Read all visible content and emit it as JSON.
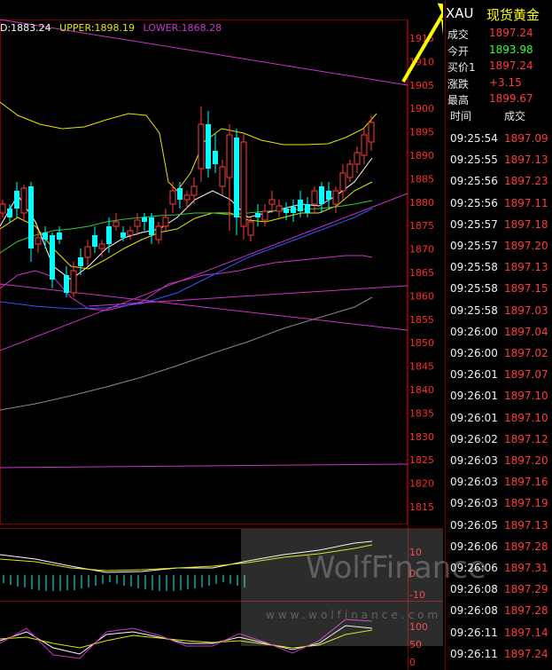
{
  "indicator_line": {
    "mid": "D:1883.24",
    "upper": "UPPER:1898.19",
    "lower": "LOWER:1868.28"
  },
  "price_axis": [
    "1915",
    "1910",
    "1905",
    "1900",
    "1895",
    "1890",
    "1885",
    "1880",
    "1875",
    "1870",
    "1865",
    "1860",
    "1855",
    "1850",
    "1845",
    "1840",
    "1835",
    "1830",
    "1825",
    "1820",
    "1815"
  ],
  "sub_axis_1": [
    "10",
    "0",
    "-10"
  ],
  "sub_axis_2": [
    "100",
    "50",
    "0"
  ],
  "quote": {
    "symbol": "XAU",
    "name": "现货黄金",
    "rows": [
      {
        "label": "成交",
        "value": "1897.24",
        "color": "#ff3b3b"
      },
      {
        "label": "今开",
        "value": "1893.98",
        "color": "#33ff33"
      },
      {
        "label": "买价1",
        "value": "1897.24",
        "color": "#ff3b3b"
      },
      {
        "label": "涨跌",
        "value": "+3.15",
        "color": "#ff3b3b"
      },
      {
        "label": "最高",
        "value": "1899.67",
        "color": "#ff3b3b"
      }
    ]
  },
  "ticks_header": {
    "time": "时间",
    "price": "成交"
  },
  "ticks": [
    {
      "time": "09:25:54",
      "price": "1897.09"
    },
    {
      "time": "09:25:55",
      "price": "1897.13"
    },
    {
      "time": "09:25:56",
      "price": "1897.23"
    },
    {
      "time": "09:25:56",
      "price": "1897.11"
    },
    {
      "time": "09:25:57",
      "price": "1897.18"
    },
    {
      "time": "09:25:57",
      "price": "1897.20"
    },
    {
      "time": "09:25:58",
      "price": "1897.13"
    },
    {
      "time": "09:25:58",
      "price": "1897.15"
    },
    {
      "time": "09:25:58",
      "price": "1897.03"
    },
    {
      "time": "09:26:00",
      "price": "1897.04"
    },
    {
      "time": "09:26:00",
      "price": "1897.02"
    },
    {
      "time": "09:26:01",
      "price": "1897.07"
    },
    {
      "time": "09:26:01",
      "price": "1897.10"
    },
    {
      "time": "09:26:01",
      "price": "1897.10"
    },
    {
      "time": "09:26:02",
      "price": "1897.12"
    },
    {
      "time": "09:26:03",
      "price": "1897.20"
    },
    {
      "time": "09:26:03",
      "price": "1897.16"
    },
    {
      "time": "09:26:03",
      "price": "1897.19"
    },
    {
      "time": "09:26:05",
      "price": "1897.13"
    },
    {
      "time": "09:26:06",
      "price": "1897.28"
    },
    {
      "time": "09:26:06",
      "price": "1897.31"
    },
    {
      "time": "09:26:08",
      "price": "1897.29"
    },
    {
      "time": "09:26:08",
      "price": "1897.28"
    },
    {
      "time": "09:26:11",
      "price": "1897.14"
    },
    {
      "time": "09:26:11",
      "price": "1897.24"
    }
  ],
  "watermark": {
    "brand": "WolfFinance",
    "url": "www.wolfinance.com"
  },
  "colors": {
    "up": "#ff3b3b",
    "down": "#00ffff",
    "annotation": "#ffff00"
  }
}
